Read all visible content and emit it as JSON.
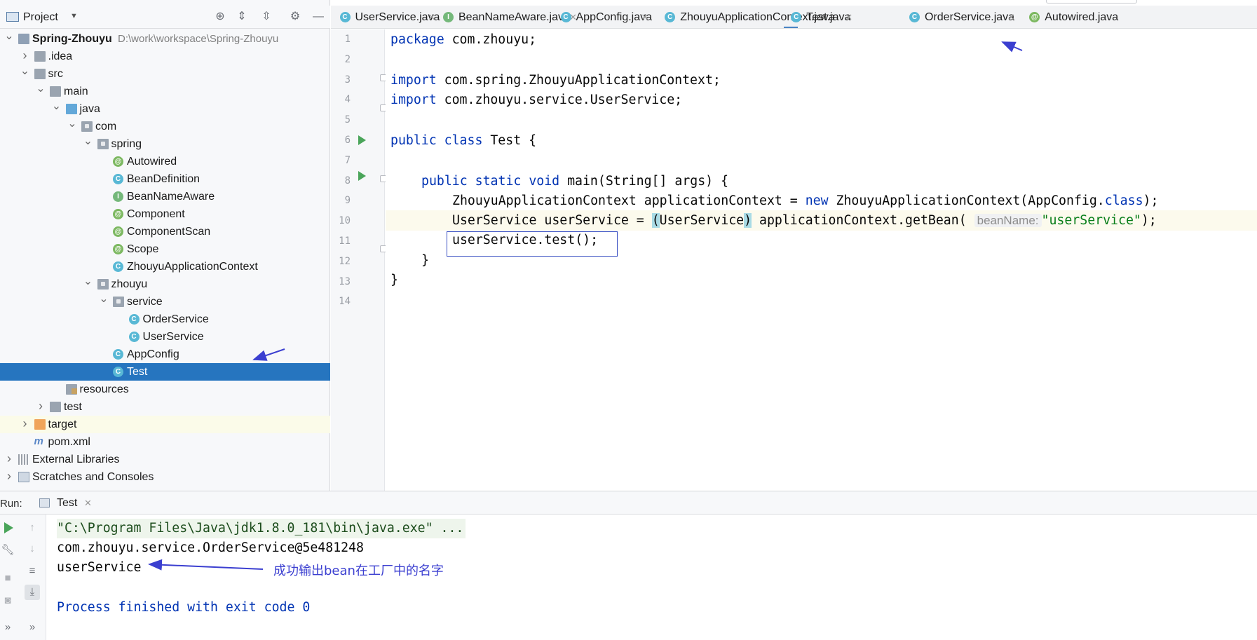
{
  "project_panel": {
    "title": "Project",
    "tree": [
      {
        "label": "Spring-Zhouyu",
        "path": "D:\\work\\workspace\\Spring-Zhouyu",
        "icon": "module-icon",
        "level": 0,
        "arrow": "v",
        "bold": true
      },
      {
        "label": ".idea",
        "icon": "folder-icon",
        "level": 1,
        "arrow": ">"
      },
      {
        "label": "src",
        "icon": "folder-icon",
        "level": 1,
        "arrow": "v"
      },
      {
        "label": "main",
        "icon": "folder-icon",
        "level": 2,
        "arrow": "v"
      },
      {
        "label": "java",
        "icon": "source-folder-icon",
        "level": 3,
        "arrow": "v"
      },
      {
        "label": "com",
        "icon": "package-icon",
        "level": 4,
        "arrow": "v"
      },
      {
        "label": "spring",
        "icon": "package-icon",
        "level": 5,
        "arrow": "v"
      },
      {
        "label": "Autowired",
        "icon": "annotation-icon",
        "level": 6
      },
      {
        "label": "BeanDefinition",
        "icon": "class-icon",
        "level": 6
      },
      {
        "label": "BeanNameAware",
        "icon": "interface-icon",
        "level": 6
      },
      {
        "label": "Component",
        "icon": "annotation-icon",
        "level": 6
      },
      {
        "label": "ComponentScan",
        "icon": "annotation-icon",
        "level": 6
      },
      {
        "label": "Scope",
        "icon": "annotation-icon",
        "level": 6
      },
      {
        "label": "ZhouyuApplicationContext",
        "icon": "class-icon",
        "level": 6
      },
      {
        "label": "zhouyu",
        "icon": "package-icon",
        "level": 5,
        "arrow": "v"
      },
      {
        "label": "service",
        "icon": "package-icon",
        "level": 6,
        "arrow": "v"
      },
      {
        "label": "OrderService",
        "icon": "class-icon",
        "level": 7
      },
      {
        "label": "UserService",
        "icon": "class-icon",
        "level": 7
      },
      {
        "label": "AppConfig",
        "icon": "class-icon",
        "level": 6
      },
      {
        "label": "Test",
        "icon": "runnable-class-icon",
        "level": 6,
        "selected": true
      },
      {
        "label": "resources",
        "icon": "resources-folder-icon",
        "level": 3
      },
      {
        "label": "test",
        "icon": "folder-icon",
        "level": 2,
        "arrow": ">"
      },
      {
        "label": "target",
        "icon": "excluded-folder-icon",
        "level": 1,
        "arrow": ">",
        "highlight": true
      },
      {
        "label": "pom.xml",
        "icon": "maven-icon",
        "level": 1
      },
      {
        "label": "External Libraries",
        "icon": "libraries-icon",
        "level": 0,
        "arrow": ">"
      },
      {
        "label": "Scratches and Consoles",
        "icon": "scratches-icon",
        "level": 0,
        "arrow": ">"
      }
    ]
  },
  "editor_tabs": [
    {
      "label": "UserService.java",
      "icon": "class-icon",
      "glyph": "C",
      "color": "#58b8d5"
    },
    {
      "label": "BeanNameAware.java",
      "icon": "interface-icon",
      "glyph": "I",
      "color": "#74b87a"
    },
    {
      "label": "AppConfig.java",
      "icon": "class-icon",
      "glyph": "C",
      "color": "#58b8d5"
    },
    {
      "label": "ZhouyuApplicationContext.java",
      "icon": "class-icon",
      "glyph": "C",
      "color": "#58b8d5"
    },
    {
      "label": "Test.java",
      "icon": "runnable-class-icon",
      "glyph": "C",
      "color": "#58b8d5",
      "active": true
    },
    {
      "label": "OrderService.java",
      "icon": "class-icon",
      "glyph": "C",
      "color": "#58b8d5"
    },
    {
      "label": "Autowired.java",
      "icon": "annotation-icon",
      "glyph": "@",
      "color": "#7cb860"
    }
  ],
  "editor": {
    "line_numbers": [
      "1",
      "2",
      "3",
      "4",
      "5",
      "6",
      "7",
      "8",
      "9",
      "10",
      "11",
      "12",
      "13",
      "14"
    ],
    "lines": {
      "l1_kw": "package",
      "l1_rest": " com.zhouyu;",
      "l3_kw": "import",
      "l3_rest": " com.spring.ZhouyuApplicationContext;",
      "l4_kw": "import",
      "l4_rest": " com.zhouyu.service.UserService;",
      "l6_kw1": "public",
      "l6_kw2": "class",
      "l6_rest": " Test {",
      "l8_kw1": "public",
      "l8_kw2": "static",
      "l8_kw3": "void",
      "l8_rest": " main(String[] args) {",
      "l9_a": "ZhouyuApplicationContext applicationContext = ",
      "l9_kw": "new",
      "l9_b": " ZhouyuApplicationContext(AppConfig.",
      "l9_cls": "class",
      "l9_c": ");",
      "l10_a": "UserService userService = ",
      "l10_p1": "(",
      "l10_b": "UserService",
      "l10_p2": ")",
      "l10_c": " applicationContext.getBean( ",
      "l10_hint": "beanName:",
      "l10_str": "\"userService\"",
      "l10_d": ");",
      "l11": "userService.test();",
      "l12": "}",
      "l13": "}"
    }
  },
  "run_panel": {
    "label": "Run:",
    "tab": "Test",
    "console": [
      "\"C:\\Program Files\\Java\\jdk1.8.0_181\\bin\\java.exe\" ...",
      "com.zhouyu.service.OrderService@5e481248",
      "userService",
      "",
      "Process finished with exit code 0"
    ],
    "annotation": "成功输出bean在工厂中的名字"
  },
  "colors": {
    "selection": "#2675bf",
    "keyword": "#0033b3",
    "string": "#067d17",
    "annotation_arrow": "#3b3fd0"
  }
}
